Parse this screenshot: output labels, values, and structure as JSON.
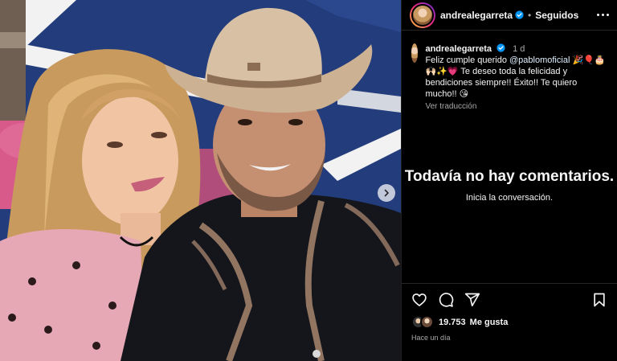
{
  "post": {
    "username": "andrealegarreta",
    "follow_state": "Seguidos",
    "header_separator": "•"
  },
  "caption": {
    "username": "andrealegarreta",
    "time": "1 d",
    "text_before_mention": "Feliz cumple querido ",
    "mention": "@pablomoficial",
    "emojis_1": "🎉🎈🎂🙌🏻✨💗",
    "text_after": " Te deseo toda la felicidad y bendiciones siempre!! Éxito!! Te quiero mucho!! ",
    "emoji_end": "😘",
    "translate_label": "Ver traducción"
  },
  "comments": {
    "empty_title": "Todavía no hay comentarios.",
    "empty_subtitle": "Inicia la conversación."
  },
  "footer": {
    "likes_count": "19.753",
    "likes_label": "Me gusta",
    "time_ago": "Hace un día"
  },
  "icons": {
    "like": "heart-icon",
    "comment": "comment-icon",
    "share": "share-icon",
    "save": "bookmark-icon",
    "verified": "verified-badge-icon",
    "more": "more-options-icon",
    "carousel_next": "chevron-right-icon"
  },
  "colors": {
    "background": "#000000",
    "text": "#f5f5f5",
    "muted": "#a8a8a8",
    "verified": "#0095f6",
    "photo_wall": "#223a7a"
  }
}
